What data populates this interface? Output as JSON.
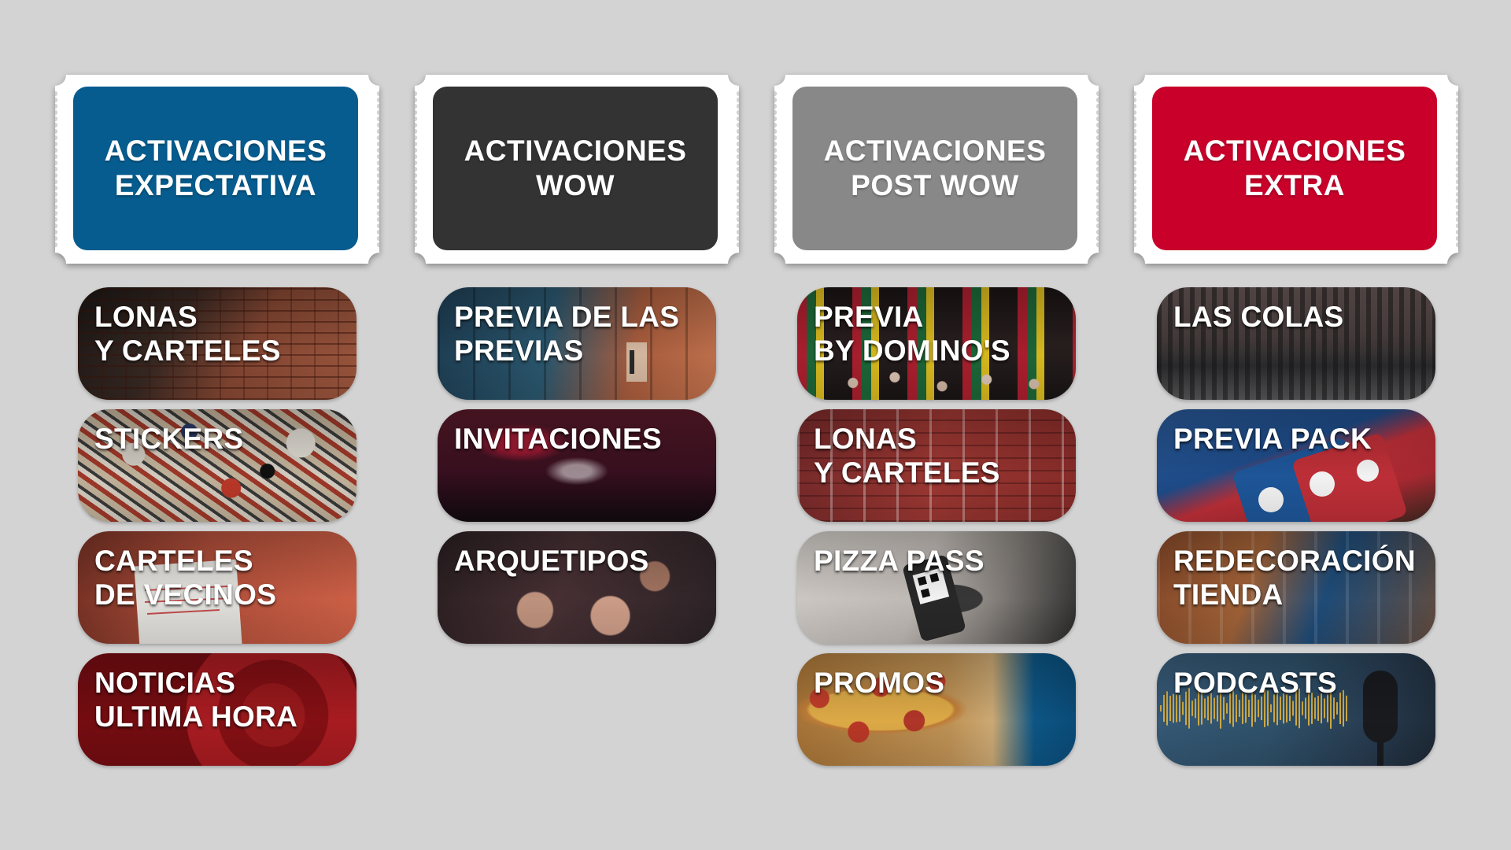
{
  "colors": {
    "background": "#d3d3d3",
    "expectativa": "#065c8e",
    "wow": "#333333",
    "post_wow": "#888888",
    "extra": "#c8002a"
  },
  "columns": [
    {
      "title": "ACTIVACIONES\nEXPECTATIVA",
      "color": "#065c8e",
      "cards": [
        {
          "label": "LONAS\nY CARTELES"
        },
        {
          "label": "STICKERS"
        },
        {
          "label": "CARTELES\nDE VECINOS"
        },
        {
          "label": "NOTICIAS\nULTIMA HORA"
        }
      ]
    },
    {
      "title": "ACTIVACIONES\nWOW",
      "color": "#333333",
      "cards": [
        {
          "label": "PREVIA DE LAS\nPREVIAS"
        },
        {
          "label": "INVITACIONES"
        },
        {
          "label": "ARQUETIPOS"
        }
      ]
    },
    {
      "title": "ACTIVACIONES\nPOST WOW",
      "color": "#888888",
      "cards": [
        {
          "label": "PREVIA\nBY DOMINO'S"
        },
        {
          "label": "LONAS\nY CARTELES"
        },
        {
          "label": "PIZZA PASS"
        },
        {
          "label": "PROMOS"
        }
      ]
    },
    {
      "title": "ACTIVACIONES\nEXTRA",
      "color": "#c8002a",
      "cards": [
        {
          "label": "LAS COLAS"
        },
        {
          "label": "PREVIA PACK"
        },
        {
          "label": "REDECORACIÓN\nTIENDA"
        },
        {
          "label": "PODCASTS"
        }
      ]
    }
  ]
}
